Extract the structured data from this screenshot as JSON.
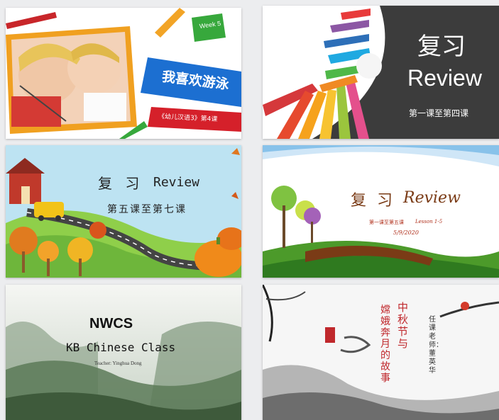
{
  "slides": [
    {
      "week_badge": "Week 5",
      "title": "我喜欢游泳",
      "subtitle": "《幼儿汉语3》第4课"
    },
    {
      "title_cn": "复习",
      "title_en": "Review",
      "subtitle": "第一课至第四课"
    },
    {
      "title_cn": "复 习",
      "title_en": "Review",
      "subtitle": "第五课至第七课"
    },
    {
      "title_cn": "复 习",
      "title_en": "Review",
      "subtitle": "第一课至第五课",
      "lesson": "Lesson 1-5",
      "date": "5/9/2020"
    },
    {
      "title": "NWCS",
      "subtitle": "KB Chinese Class",
      "teacher": "Teacher: Yinghua Dong"
    },
    {
      "title_a": "中秋节与",
      "title_b": "嫦娥奔月的故事",
      "teacher": "任课老师：董英华"
    }
  ],
  "colors": {
    "banner_blue": "#1c6fd1",
    "banner_red": "#d5202a",
    "badge_green": "#37a83c",
    "review_dark": "#3c3c3c",
    "ink_red": "#c0282c"
  }
}
